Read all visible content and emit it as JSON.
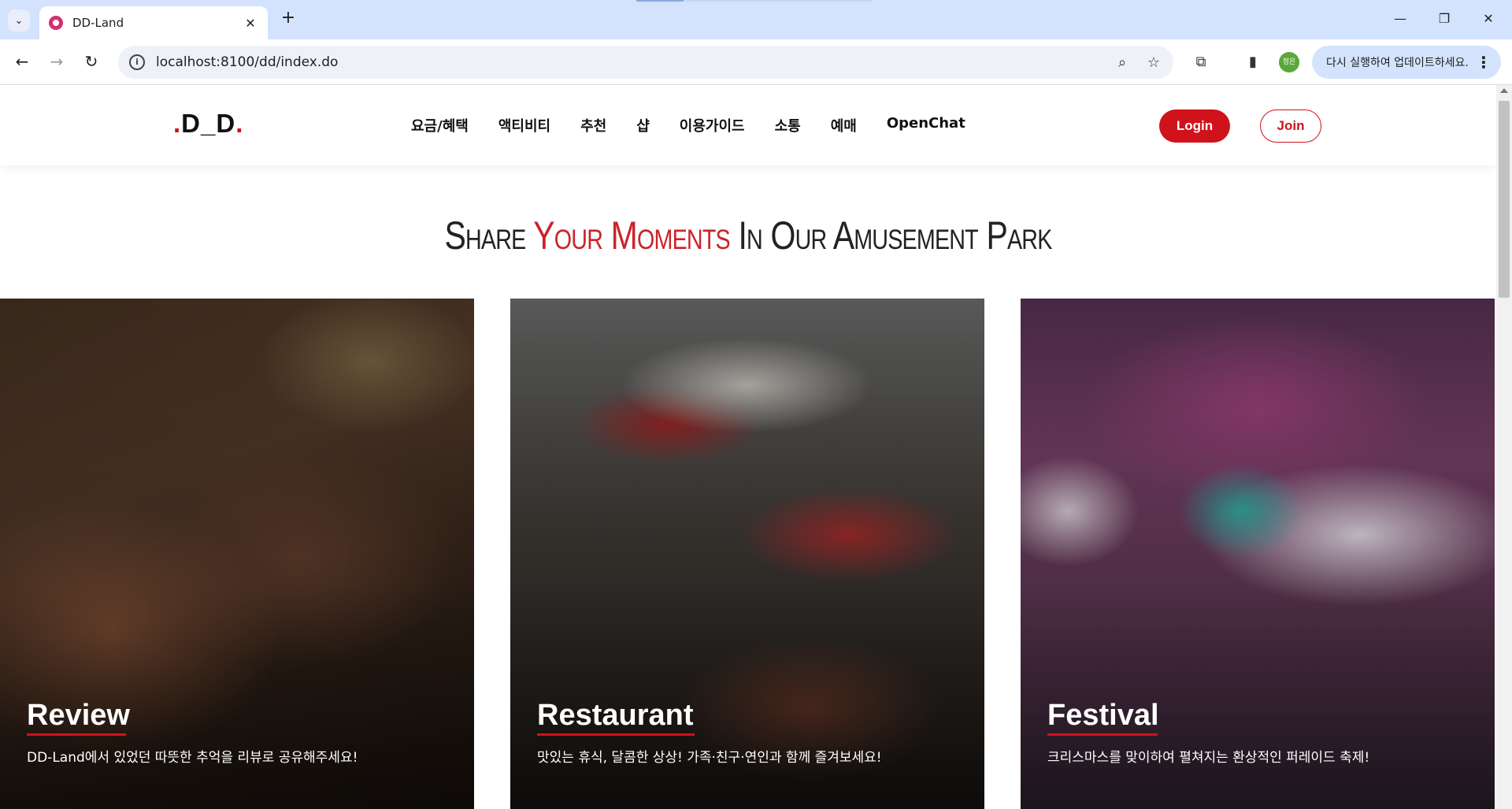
{
  "browser": {
    "tab_title": "DD-Land",
    "tab_close": "✕",
    "new_tab": "+",
    "url": "localhost:8100/dd/index.do",
    "profile_label": "정은",
    "update_label": "다시 실행하여 업데이트하세요.",
    "window_controls": {
      "minimize": "—",
      "restore": "❐",
      "close": "✕"
    }
  },
  "site": {
    "logo_dot_left": ".",
    "logo_text": "D_D",
    "logo_dot_right": ".",
    "nav": [
      "요금/혜택",
      "액티비티",
      "추천",
      "샵",
      "이용가이드",
      "소통",
      "예매",
      "OpenChat"
    ],
    "login_label": "Login",
    "join_label": "Join",
    "accent_color": "#d0121b"
  },
  "headline": {
    "part1": "Share ",
    "accent": "Your Moments",
    "part2": " In Our Amusement Park"
  },
  "cards": [
    {
      "title": "Review",
      "desc": "DD-Land에서 있었던 따뜻한 추억을 리뷰로 공유해주세요!"
    },
    {
      "title": "Restaurant",
      "desc": "맛있는 휴식, 달콤한 상상! 가족·친구·연인과 함께 즐겨보세요!"
    },
    {
      "title": "Festival",
      "desc": "크리스마스를 맞이하여 펼쳐지는 환상적인 퍼레이드 축제!"
    }
  ]
}
